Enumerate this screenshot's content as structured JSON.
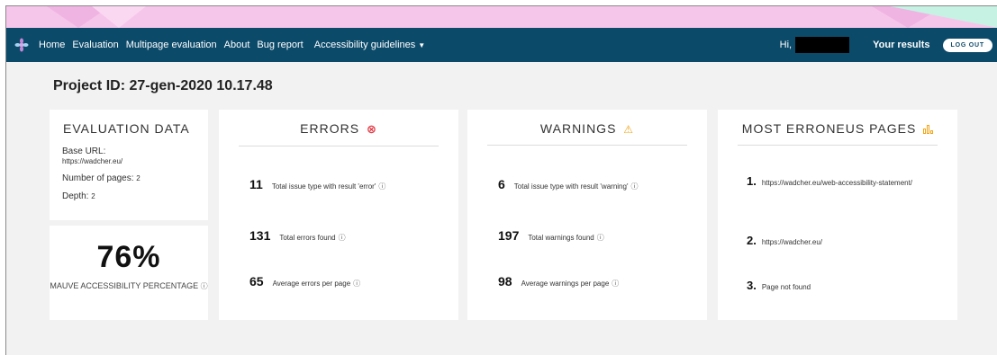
{
  "nav": {
    "home": "Home",
    "evaluation": "Evaluation",
    "multipage": "Multipage evaluation",
    "about": "About",
    "bug_report": "Bug report",
    "guidelines": "Accessibility guidelines",
    "greeting": "Hi,",
    "your_results": "Your results",
    "logout": "LOG OUT"
  },
  "project_title": "Project ID: 27-gen-2020 10.17.48",
  "evaluation_data": {
    "title": "EVALUATION DATA",
    "base_url_label": "Base URL:",
    "base_url": "https://wadcher.eu/",
    "pages_label": "Number of pages:",
    "pages": "2",
    "depth_label": "Depth:",
    "depth": "2"
  },
  "accessibility": {
    "percentage": "76%",
    "label": "MAUVE ACCESSIBILITY PERCENTAGE"
  },
  "errors": {
    "title": "ERRORS",
    "items": [
      {
        "num": "11",
        "text": "Total issue type with result 'error'"
      },
      {
        "num": "131",
        "text": "Total errors found"
      },
      {
        "num": "65",
        "text": "Average errors per page"
      }
    ]
  },
  "warnings": {
    "title": "WARNINGS",
    "items": [
      {
        "num": "6",
        "text": "Total issue type with result 'warning'"
      },
      {
        "num": "197",
        "text": "Total warnings found"
      },
      {
        "num": "98",
        "text": "Average warnings per page"
      }
    ]
  },
  "most_erroneous": {
    "title": "MOST ERRONEUS PAGES",
    "items": [
      {
        "rank": "1.",
        "text": "https://wadcher.eu/web-accessibility-statement/"
      },
      {
        "rank": "2.",
        "text": "https://wadcher.eu/"
      },
      {
        "rank": "3.",
        "text": "Page not found"
      }
    ]
  },
  "colors": {
    "navbar": "#0c4a6a",
    "banner": "#f6c6ea",
    "error": "#e23b45",
    "warning": "#f2a515"
  }
}
